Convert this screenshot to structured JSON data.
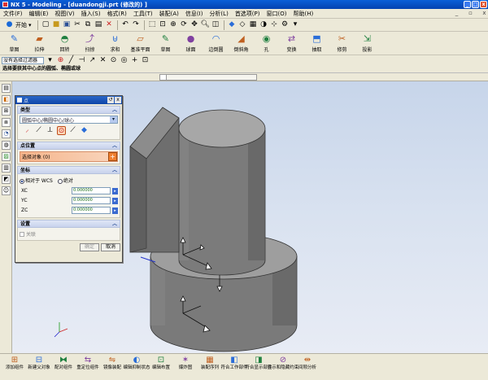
{
  "window": {
    "title": "NX 5 - Modeling - [duandongji.prt  (修改的) ]",
    "buttons": [
      "_",
      "□",
      "x"
    ]
  },
  "menu": {
    "items": [
      "文件(F)",
      "编辑(E)",
      "视图(V)",
      "插入(S)",
      "格式(R)",
      "工具(T)",
      "装配(A)",
      "信息(I)",
      "分析(L)",
      "首选项(P)",
      "窗口(O)",
      "帮助(H)"
    ]
  },
  "toolbar1": {
    "start_label": "开始"
  },
  "toolbar2": {
    "tools": [
      {
        "label": "草图",
        "icon": "sketch-icon"
      },
      {
        "label": "拉伸",
        "icon": "extrude-icon"
      },
      {
        "label": "回转",
        "icon": "revolve-icon"
      },
      {
        "label": "扫掠",
        "icon": "sweep-icon"
      },
      {
        "label": "求和",
        "icon": "unite-icon"
      },
      {
        "label": "基准平面",
        "icon": "datum-plane-icon"
      },
      {
        "label": "草图",
        "icon": "sketch2-icon"
      },
      {
        "label": "球面",
        "icon": "sphere-icon"
      },
      {
        "label": "边倒圆",
        "icon": "edge-blend-icon"
      },
      {
        "label": "倒斜角",
        "icon": "chamfer-icon"
      },
      {
        "label": "孔",
        "icon": "hole-icon"
      },
      {
        "label": "变换",
        "icon": "transform-icon"
      },
      {
        "label": "抽取",
        "icon": "extract-icon"
      },
      {
        "label": "修剪",
        "icon": "trim-icon"
      },
      {
        "label": "投影",
        "icon": "project-icon"
      }
    ]
  },
  "toolbar3": {
    "filter_value": "没有选择过滤器"
  },
  "cue": "选择要获其中心点的圆弧、椭圆或球",
  "dialog": {
    "title": "点",
    "type_section": "类型",
    "type_value": "圆弧中心/椭圆中心/球心",
    "point_section": "点位置",
    "select_object": "选择对象 (0)",
    "coord_section": "坐标",
    "radio_wcs": "相对于 WCS",
    "radio_abs": "绝对",
    "fields": [
      {
        "label": "XC",
        "value": "0.000000"
      },
      {
        "label": "YC",
        "value": "0.000000"
      },
      {
        "label": "ZC",
        "value": "0.000000"
      }
    ],
    "settings_section": "设置",
    "assoc_label": "关联",
    "ok_label": "确定",
    "cancel_label": "取消"
  },
  "bottombar": {
    "tools": [
      {
        "label": "添加组件",
        "icon": "add-component-icon"
      },
      {
        "label": "新建父对象",
        "icon": "new-parent-icon"
      },
      {
        "label": "配对组件",
        "icon": "mate-component-icon"
      },
      {
        "label": "重定位组件",
        "icon": "reposition-component-icon"
      },
      {
        "label": "镜像装配",
        "icon": "mirror-assembly-icon"
      },
      {
        "label": "编辑抑制状态",
        "icon": "edit-suppression-icon"
      },
      {
        "label": "编辑布置",
        "icon": "edit-arrangement-icon"
      },
      {
        "label": "爆炸图",
        "icon": "exploded-view-icon"
      },
      {
        "label": "装配序列",
        "icon": "assembly-sequence-icon"
      },
      {
        "label": "符合工作部件",
        "icon": "work-part-icon"
      },
      {
        "label": "符合显示部件",
        "icon": "display-part-icon"
      },
      {
        "label": "显示和隐藏约束",
        "icon": "show-hide-constraints-icon"
      },
      {
        "label": "间隙分析",
        "icon": "clearance-analysis-icon"
      }
    ]
  }
}
